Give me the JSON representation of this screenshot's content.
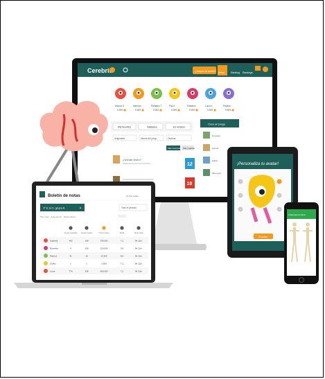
{
  "colors": {
    "teal": "#1f5f5a",
    "teal_light": "#2b7a72",
    "orange": "#f39a1e",
    "brain_pink": "#f8b3a6",
    "green": "#2fa84f",
    "frame": "#000000"
  },
  "brand": {
    "name": "Cerebriti"
  },
  "desktop": {
    "top_button": "¿Juegas la sesión?",
    "nav_items": [
      "Retos",
      "Ranking",
      "Rankings"
    ],
    "podium": [
      {
        "name": "Moncio 5",
        "pts": "9.999"
      },
      {
        "name": "Marcela",
        "pts": "9.999"
      },
      {
        "name": "Pantaleo 7",
        "pts": "9.999"
      },
      {
        "name": "Pipi 5",
        "pts": "9.999"
      },
      {
        "name": "Pantalón",
        "pts": "9.999"
      },
      {
        "name": "Lucía 4",
        "pts": "9.999"
      },
      {
        "name": "Paulina",
        "pts": "9.999"
      }
    ],
    "filter_tabs": [
      "Mis favoritos",
      "Validados",
      "En revisión"
    ],
    "selects": [
      "Asignatura",
      "Idioma del juego",
      "Ordenar"
    ],
    "sort_buttons": [
      "Más recientes",
      "Más jugados"
    ],
    "create_button": "Crea un juego",
    "game_title": "¿Dónde viven?",
    "side_items": [
      "En juego",
      "Acierto",
      "Fallos",
      "Mis reyes"
    ],
    "date_num_1": "12",
    "date_num_2": "18"
  },
  "laptop": {
    "title": "Boletín de notas",
    "header_right": "Cerrar sesión",
    "group_select": "1º E.S.O. grupo A",
    "period_select": "Todo el periodo",
    "breadcrumb": "Mis notas · Asignaturas · Matemáticas",
    "columns": [
      "Juegos realizados",
      "Juegos creados",
      "Puntos totales",
      "Media",
      "Tiempo total"
    ],
    "rows": [
      {
        "name": "Gabriela",
        "vals": [
          "462",
          "108",
          "700.000",
          "7,1",
          "9h 12m"
        ]
      },
      {
        "name": "Rosendo",
        "vals": [
          "4",
          "108",
          "120.000",
          "3,5",
          "9h 12m"
        ]
      },
      {
        "name": "Patricia",
        "vals": [
          "41",
          "16",
          "13.300",
          "8,9",
          "9h 12m"
        ]
      },
      {
        "name": "Carlos",
        "vals": [
          "1",
          "1",
          "2.000",
          "7,1",
          "9h 12m"
        ]
      },
      {
        "name": "Lucía",
        "vals": [
          "774",
          "108",
          "600.000",
          "7,1",
          "9h 12m"
        ]
      }
    ]
  },
  "tablet": {
    "title": "¡Personaliza tu avatar!",
    "button": "Guardar"
  },
  "phone": {
    "header": "Anatomía humana"
  }
}
